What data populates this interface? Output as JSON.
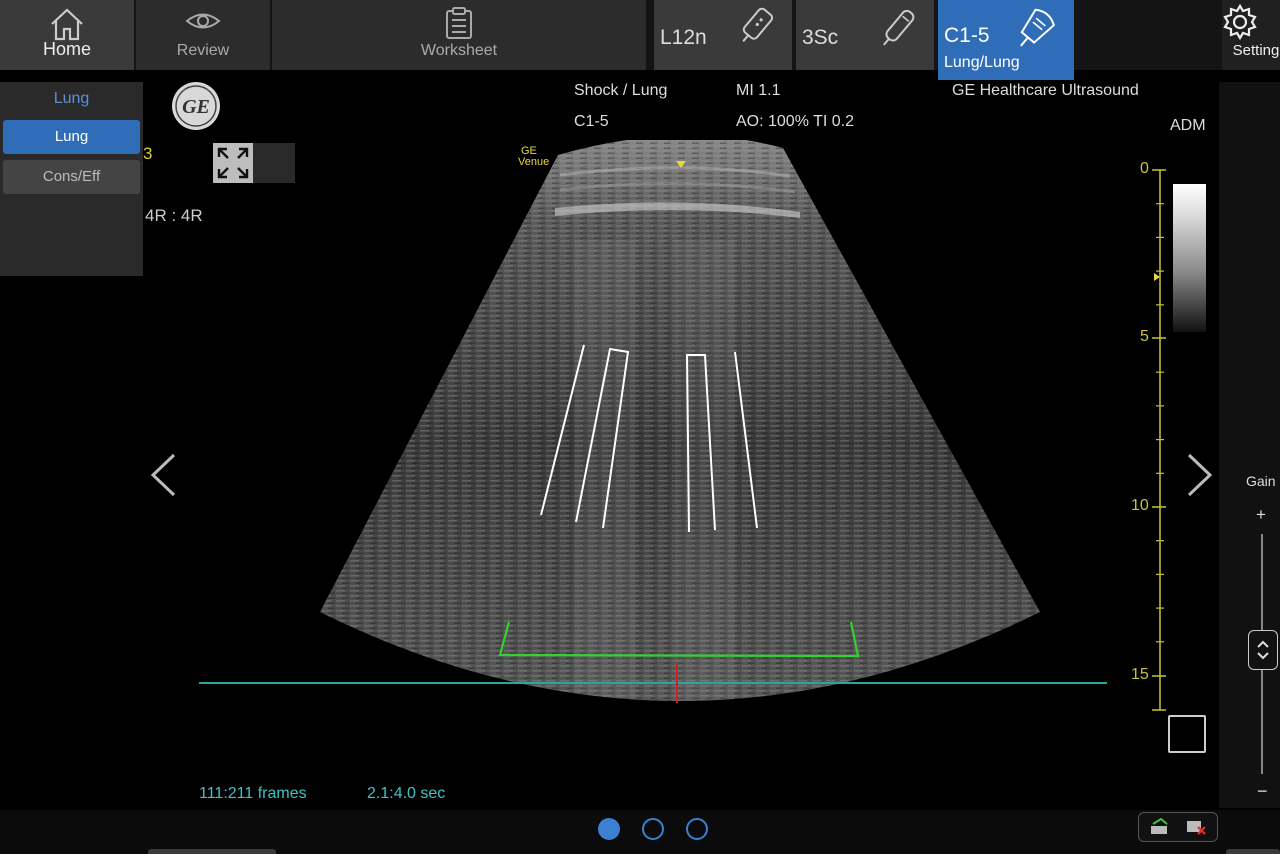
{
  "nav": {
    "home_label": "Home",
    "review_label": "Review",
    "worksheet_label": "Worksheet",
    "settings_label": "Setting"
  },
  "probes": {
    "l12n": "L12n",
    "sc3": "3Sc",
    "c15": "C1-5",
    "c15_preset": "Lung/Lung"
  },
  "presets": {
    "header": "Lung",
    "items": [
      "Lung",
      "Cons/Eff"
    ]
  },
  "overlay": {
    "left_number": "3",
    "ratio": "4R : 4R",
    "exam": "Shock / Lung",
    "probe": "C1-5",
    "mi": "MI 1.1",
    "ao_ti": "AO: 100% TI 0.2",
    "brand": "GE Healthcare Ultrasound",
    "adm": "ADM",
    "venue_brand": "GE",
    "venue_name": "Venue",
    "gain": "Gain",
    "gain_plus": "+",
    "gain_minus": "−"
  },
  "depth_scale": {
    "labels": [
      "0",
      "5",
      "10",
      "15"
    ]
  },
  "cine": {
    "frames": "111:211 frames",
    "time": "2.1:4.0 sec"
  },
  "page_dots": {
    "count": 3,
    "active": 0
  },
  "colors": {
    "accent": "#2f6db8",
    "scale": "#c9c23a",
    "cine_text": "#3fc4c4",
    "marker_green": "#34d034",
    "baseline": "#2aa79b"
  }
}
